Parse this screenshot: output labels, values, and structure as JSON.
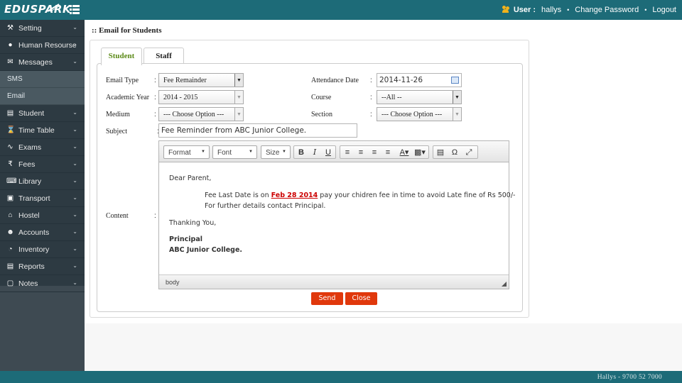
{
  "brand": {
    "logo": "EDUSPARK"
  },
  "topbar": {
    "user_label": "User :",
    "user_name": "hallys",
    "change_password": "Change Password",
    "logout": "Logout",
    "separator": "•"
  },
  "sidebar": {
    "items": [
      {
        "label": "Setting",
        "icon": "wrench-icon"
      },
      {
        "label": "Human Resourse",
        "icon": "person-icon"
      },
      {
        "label": "Messages",
        "icon": "envelope-icon"
      },
      {
        "label": "Student",
        "icon": "database-icon"
      },
      {
        "label": "Time Table",
        "icon": "hourglass-icon"
      },
      {
        "label": "Exams",
        "icon": "rss-icon"
      },
      {
        "label": "Fees",
        "icon": "rupee-icon"
      },
      {
        "label": "Library",
        "icon": "book-icon"
      },
      {
        "label": "Transport",
        "icon": "car-icon"
      },
      {
        "label": "Hostel",
        "icon": "home-icon"
      },
      {
        "label": "Accounts",
        "icon": "users-icon"
      },
      {
        "label": "Inventory",
        "icon": "gauge-icon"
      },
      {
        "label": "Reports",
        "icon": "bar-chart-icon"
      },
      {
        "label": "Notes",
        "icon": "file-icon"
      }
    ],
    "sub_items": [
      "SMS",
      "Email"
    ]
  },
  "page": {
    "title": ":: Email for Students"
  },
  "tabs": [
    {
      "label": "Student",
      "active": true
    },
    {
      "label": "Staff",
      "active": false
    }
  ],
  "form": {
    "email_type": {
      "label": "Email Type",
      "value": "Fee Remainder"
    },
    "academic_year": {
      "label": "Academic Year",
      "value": "2014 - 2015"
    },
    "medium": {
      "label": "Medium",
      "value": "--- Choose Option ---"
    },
    "subject": {
      "label": "Subject",
      "value": "Fee Reminder from ABC Junior College."
    },
    "content": {
      "label": "Content"
    },
    "attendance_date": {
      "label": "Attendance Date",
      "value": "2014-11-26"
    },
    "course": {
      "label": "Course",
      "value": "--All --"
    },
    "section": {
      "label": "Section",
      "value": "--- Choose Option ---"
    },
    "colon": ":"
  },
  "editor": {
    "toolbar": {
      "format": "Format",
      "font": "Font",
      "size": "Size"
    },
    "body": {
      "greeting": "Dear Parent,",
      "line1_pre": "Fee Last Date is on ",
      "line1_date": "Feb 28 2014",
      "line1_post": " pay your chidren fee in time to avoid Late fine of Rs 500/-",
      "line2": "For further details contact Principal.",
      "thanks": "Thanking You,",
      "sign1": "Principal",
      "sign2": "ABC Junior College."
    },
    "status": "body"
  },
  "actions": {
    "send": "Send",
    "close": "Close"
  },
  "footer": {
    "text": "Hallys - 9700 52 7000"
  },
  "colors": {
    "primary": "#1d6b78",
    "sidebar": "#2d3a42",
    "button": "#e0380c",
    "active_tab": "#5c8a18",
    "highlight": "#cc0000"
  }
}
